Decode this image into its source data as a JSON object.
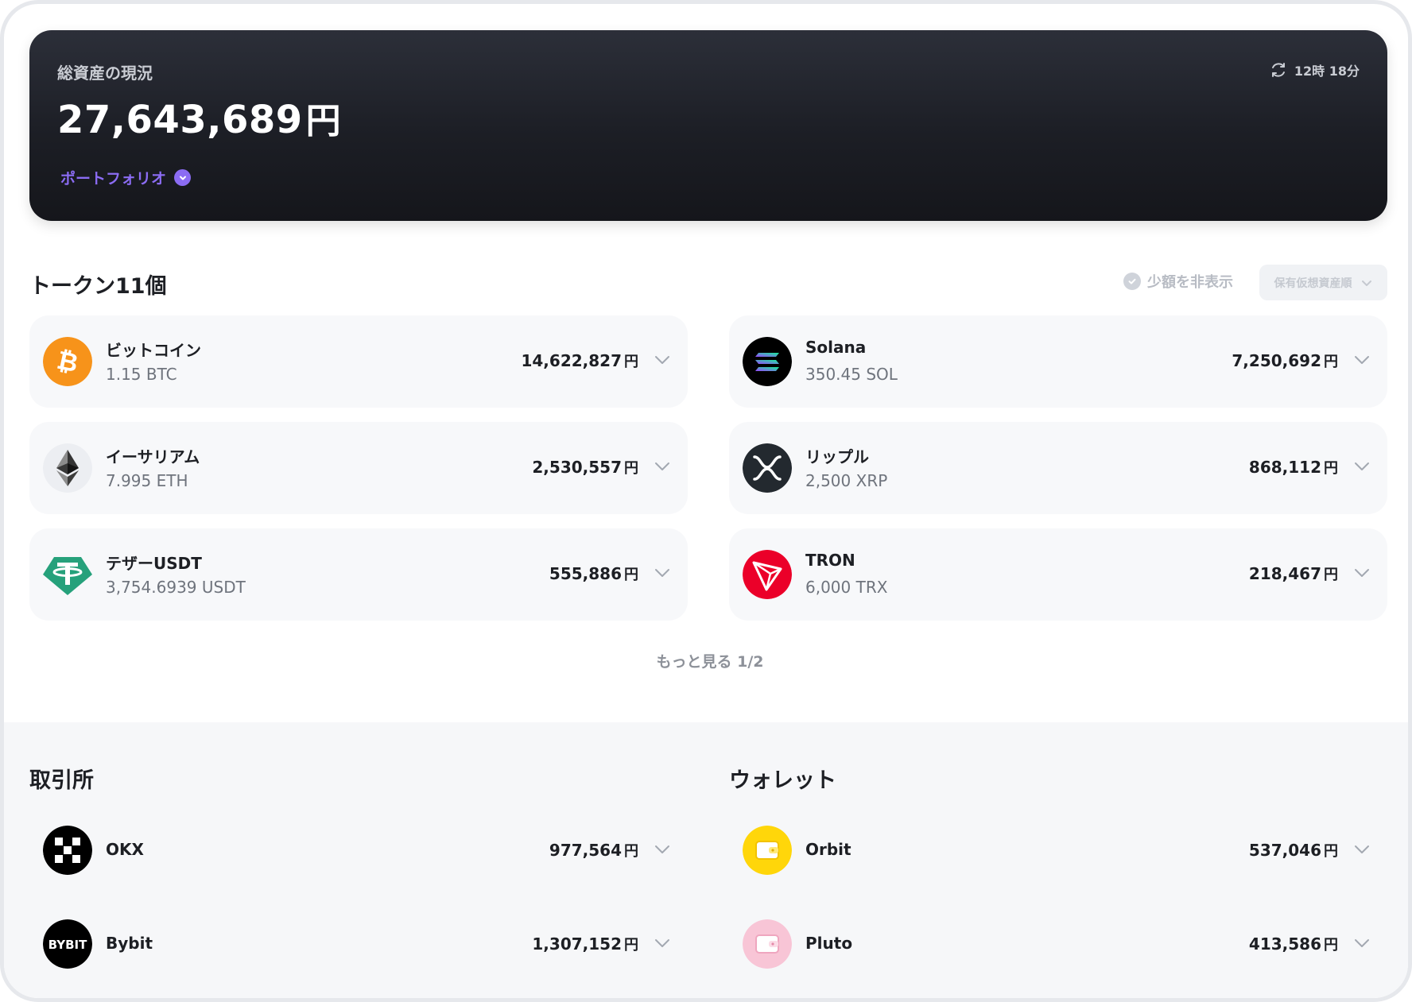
{
  "summary": {
    "label": "総資産の現況",
    "total": "27,643,689",
    "unit": "円",
    "portfolio_link": "ポートフォリオ",
    "refresh_time": "12時 18分"
  },
  "tokens": {
    "title": "トークン11個",
    "hide_small_label": "少額を非表示",
    "sort_label": "保有仮想資産順",
    "items": [
      {
        "name": "ビットコイン",
        "amount": "1.15 BTC",
        "value": "14,622,827",
        "unit": "円",
        "icon": "bitcoin-icon"
      },
      {
        "name": "Solana",
        "amount": "350.45 SOL",
        "value": "7,250,692",
        "unit": "円",
        "icon": "solana-icon"
      },
      {
        "name": "イーサリアム",
        "amount": "7.995 ETH",
        "value": "2,530,557",
        "unit": "円",
        "icon": "ethereum-icon"
      },
      {
        "name": "リップル",
        "amount": "2,500 XRP",
        "value": "868,112",
        "unit": "円",
        "icon": "xrp-icon"
      },
      {
        "name": "テザーUSDT",
        "amount": "3,754.6939 USDT",
        "value": "555,886",
        "unit": "円",
        "icon": "tether-icon"
      },
      {
        "name": "TRON",
        "amount": "6,000 TRX",
        "value": "218,467",
        "unit": "円",
        "icon": "tron-icon"
      }
    ],
    "more_label": "もっと見る 1/2"
  },
  "exchanges": {
    "title": "取引所",
    "items": [
      {
        "name": "OKX",
        "value": "977,564",
        "unit": "円",
        "icon": "okx-icon"
      },
      {
        "name": "Bybit",
        "value": "1,307,152",
        "unit": "円",
        "icon": "bybit-icon",
        "logo_text": "BYBIT"
      }
    ]
  },
  "wallets": {
    "title": "ウォレット",
    "items": [
      {
        "name": "Orbit",
        "value": "537,046",
        "unit": "円",
        "icon": "wallet-icon"
      },
      {
        "name": "Pluto",
        "value": "413,586",
        "unit": "円",
        "icon": "wallet-icon"
      }
    ]
  },
  "colors": {
    "accent": "#8b6cf3",
    "bitcoin": "#f7931a",
    "tether": "#26a17b",
    "tron": "#eb0029",
    "orbit": "#ffd60a",
    "pluto": "#f8c5d6"
  }
}
